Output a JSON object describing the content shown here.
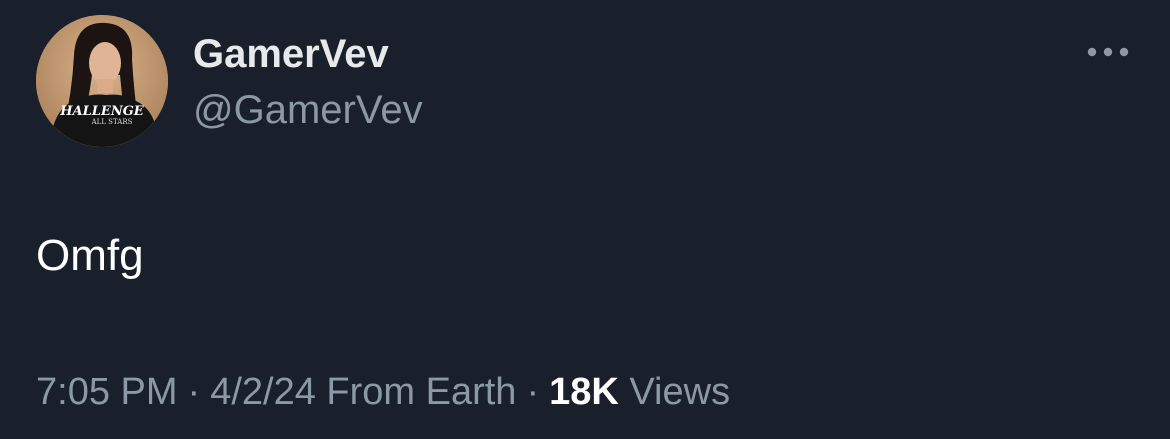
{
  "tweet": {
    "author": {
      "display_name": "GamerVev",
      "handle": "@GamerVev",
      "avatar_shirt_text": "HALLENGE",
      "avatar_shirt_subtext": "ALL STARS"
    },
    "more_icon": "more-horizontal-icon",
    "text": "Omfg",
    "meta": {
      "time": "7:05 PM",
      "separator": "·",
      "date": "4/2/24",
      "source": "From Earth",
      "views_count": "18K",
      "views_label": "Views"
    }
  },
  "colors": {
    "background": "#1a202b",
    "primary_text": "#e7e9ea",
    "secondary_text": "#8b98a5"
  }
}
